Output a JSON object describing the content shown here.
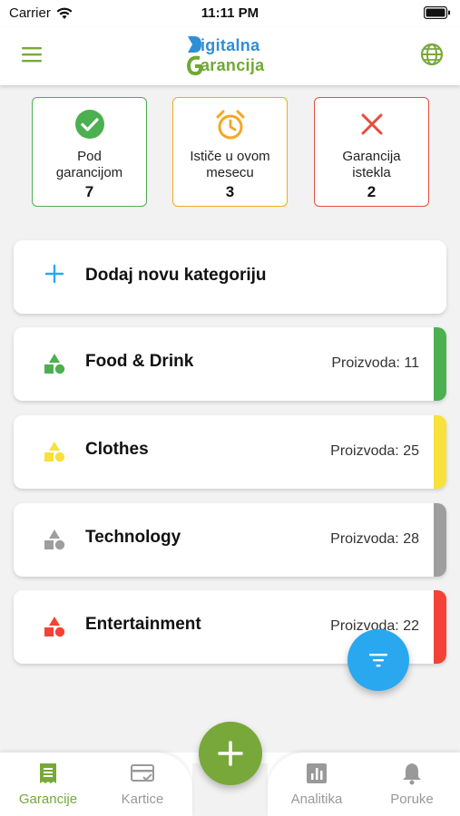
{
  "status_bar": {
    "carrier": "Carrier",
    "time": "11:11 PM"
  },
  "header": {
    "logo_line1": "igitalna",
    "logo_line2": "arancija",
    "logo_d": "D",
    "logo_g": "G"
  },
  "summary": [
    {
      "label_line1": "Pod",
      "label_line2": "garancijom",
      "count": "7",
      "icon": "check-circle-icon",
      "color": "#4caf50"
    },
    {
      "label_line1": "Ističe u ovom",
      "label_line2": "mesecu",
      "count": "3",
      "icon": "alarm-clock-icon",
      "color": "#f5a623"
    },
    {
      "label_line1": "Garancija",
      "label_line2": "istekla",
      "count": "2",
      "icon": "close-icon",
      "color": "#e74c3c"
    }
  ],
  "add_category": {
    "label": "Dodaj novu kategoriju"
  },
  "categories": [
    {
      "name": "Food & Drink",
      "count_text": "Proizvoda: 11",
      "color": "#4caf50"
    },
    {
      "name": "Clothes",
      "count_text": "Proizvoda: 25",
      "color": "#f7e13a"
    },
    {
      "name": "Technology",
      "count_text": "Proizvoda: 28",
      "color": "#9e9e9e"
    },
    {
      "name": "Entertainment",
      "count_text": "Proizvoda: 22",
      "color": "#f44336"
    }
  ],
  "bottom_nav": [
    {
      "label": "Garancije",
      "icon": "document-icon",
      "active": true
    },
    {
      "label": "Kartice",
      "icon": "card-icon",
      "active": false
    },
    {
      "label": "Analitika",
      "icon": "bar-chart-icon",
      "active": false
    },
    {
      "label": "Poruke",
      "icon": "bell-icon",
      "active": false
    }
  ],
  "colors": {
    "primary_green": "#78a83a",
    "accent_blue": "#29a8f0"
  }
}
